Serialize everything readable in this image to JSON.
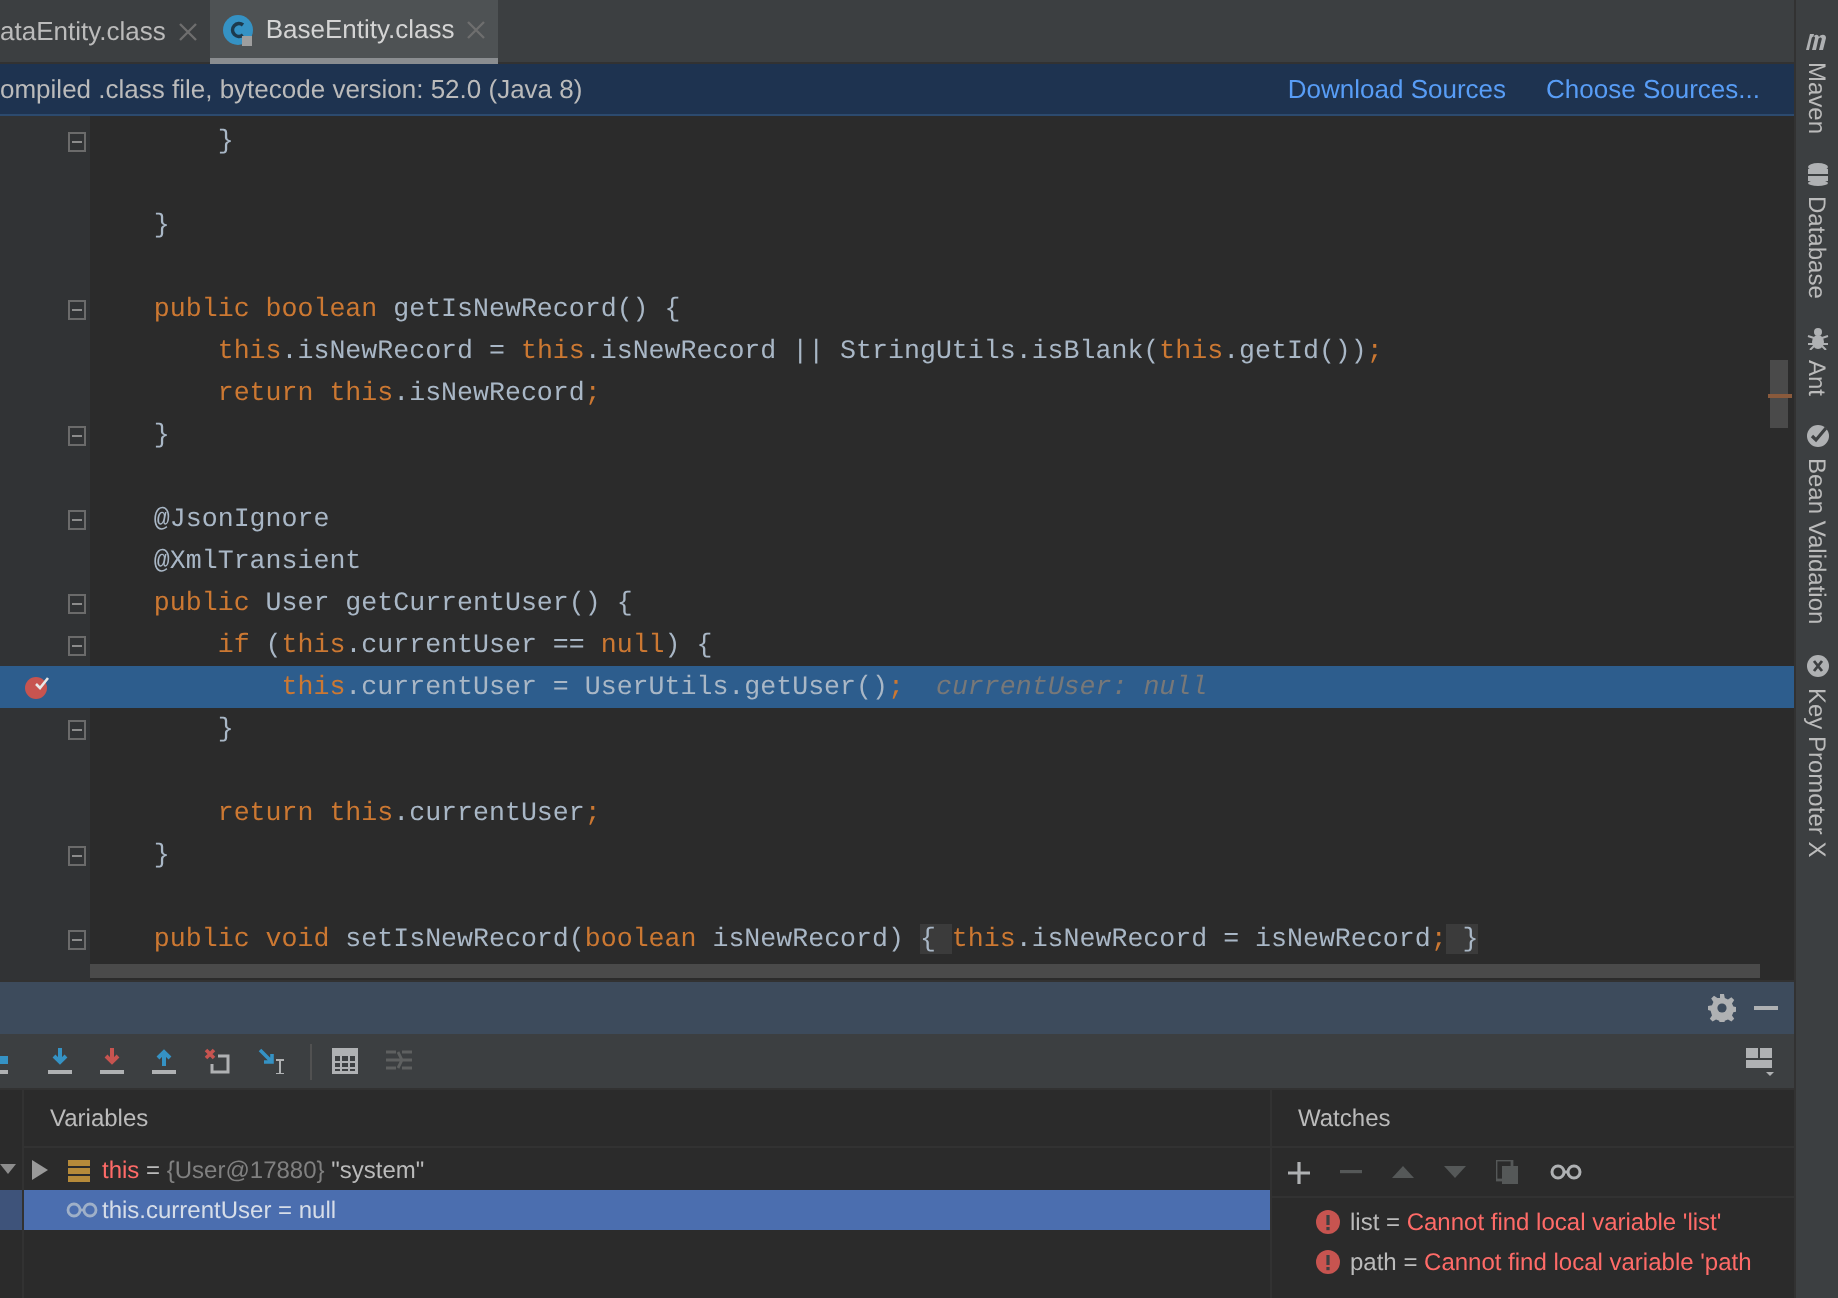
{
  "tabs": [
    {
      "label": "ataEntity.class",
      "selected": false
    },
    {
      "label": "BaseEntity.class",
      "selected": true
    }
  ],
  "banner": {
    "message": "ompiled .class file, bytecode version: 52.0 (Java 8)",
    "links": [
      "Download Sources",
      "Choose Sources..."
    ]
  },
  "code_lines": [
    {
      "fold_marker": true,
      "breakpoint": false,
      "selected": false,
      "tokens": [
        {
          "kind": "plain",
          "text": "        }"
        }
      ]
    },
    {
      "fold_marker": false,
      "breakpoint": false,
      "selected": false
    },
    {
      "fold_marker": false,
      "breakpoint": false,
      "selected": false,
      "tokens": [
        {
          "kind": "plain",
          "text": "    }"
        }
      ]
    },
    {
      "fold_marker": false,
      "breakpoint": false,
      "selected": false
    },
    {
      "fold_marker": true,
      "breakpoint": false,
      "selected": false,
      "tokens": [
        {
          "kind": "keyword",
          "text": "    public boolean "
        },
        {
          "kind": "plain",
          "text": "getIsNewRecord() {"
        }
      ]
    },
    {
      "fold_marker": false,
      "breakpoint": false,
      "selected": false,
      "tokens": [
        {
          "kind": "keyword",
          "text": "        this"
        },
        {
          "kind": "plain",
          "text": ".isNewRecord = "
        },
        {
          "kind": "keyword",
          "text": "this"
        },
        {
          "kind": "plain",
          "text": ".isNewRecord || StringUtils.isBlank("
        },
        {
          "kind": "keyword",
          "text": "this"
        },
        {
          "kind": "plain",
          "text": ".getId())"
        },
        {
          "kind": "keyword",
          "text": ";"
        }
      ]
    },
    {
      "fold_marker": false,
      "breakpoint": false,
      "selected": false,
      "tokens": [
        {
          "kind": "keyword",
          "text": "        return this"
        },
        {
          "kind": "plain",
          "text": ".isNewRecord"
        },
        {
          "kind": "keyword",
          "text": ";"
        }
      ]
    },
    {
      "fold_marker": true,
      "breakpoint": false,
      "selected": false,
      "tokens": [
        {
          "kind": "plain",
          "text": "    }"
        }
      ]
    },
    {
      "fold_marker": false,
      "breakpoint": false,
      "selected": false
    },
    {
      "fold_marker": true,
      "breakpoint": false,
      "selected": false,
      "tokens": [
        {
          "kind": "plain",
          "text": "    @JsonIgnore"
        }
      ]
    },
    {
      "fold_marker": false,
      "breakpoint": false,
      "selected": false,
      "tokens": [
        {
          "kind": "plain",
          "text": "    @XmlTransient"
        }
      ]
    },
    {
      "fold_marker": true,
      "breakpoint": false,
      "selected": false,
      "tokens": [
        {
          "kind": "keyword",
          "text": "    public "
        },
        {
          "kind": "plain",
          "text": "User getCurrentUser() {"
        }
      ]
    },
    {
      "fold_marker": true,
      "breakpoint": false,
      "selected": false,
      "tokens": [
        {
          "kind": "keyword",
          "text": "        if "
        },
        {
          "kind": "plain",
          "text": "("
        },
        {
          "kind": "keyword",
          "text": "this"
        },
        {
          "kind": "plain",
          "text": ".currentUser == "
        },
        {
          "kind": "keyword",
          "text": "null"
        },
        {
          "kind": "plain",
          "text": ") {"
        }
      ]
    },
    {
      "fold_marker": false,
      "breakpoint": true,
      "selected": true,
      "tokens": [
        {
          "kind": "keyword",
          "text": "            this"
        },
        {
          "kind": "plain",
          "text": ".currentUser = UserUtils.getUser()"
        },
        {
          "kind": "keyword",
          "text": ";"
        },
        {
          "kind": "hint",
          "text": "currentUser: null"
        }
      ]
    },
    {
      "fold_marker": true,
      "breakpoint": false,
      "selected": false,
      "tokens": [
        {
          "kind": "plain",
          "text": "        }"
        }
      ]
    },
    {
      "fold_marker": false,
      "breakpoint": false,
      "selected": false
    },
    {
      "fold_marker": false,
      "breakpoint": false,
      "selected": false,
      "tokens": [
        {
          "kind": "keyword",
          "text": "        return this"
        },
        {
          "kind": "plain",
          "text": ".currentUser"
        },
        {
          "kind": "keyword",
          "text": ";"
        }
      ]
    },
    {
      "fold_marker": true,
      "breakpoint": false,
      "selected": false,
      "tokens": [
        {
          "kind": "plain",
          "text": "    }"
        }
      ]
    },
    {
      "fold_marker": false,
      "breakpoint": false,
      "selected": false
    },
    {
      "fold_marker": true,
      "breakpoint": false,
      "selected": false,
      "tokens": [
        {
          "kind": "keyword",
          "text": "    public void "
        },
        {
          "kind": "plain",
          "text": "setIsNewRecord("
        },
        {
          "kind": "keyword",
          "text": "boolean "
        },
        {
          "kind": "plain",
          "text": "isNewRecord) "
        },
        {
          "kind": "fold",
          "text": "{ "
        },
        {
          "kind": "keyword",
          "text": "this"
        },
        {
          "kind": "plain",
          "text": ".isNewRecord = isNewRecord"
        },
        {
          "kind": "keyword",
          "text": ";"
        },
        {
          "kind": "fold",
          "text": " }"
        }
      ]
    }
  ],
  "variables": {
    "title": "Variables",
    "rows": [
      {
        "kind": "object",
        "name": "this",
        "operator": "=",
        "value_type": "{User@17880}",
        "value": "\"system\"",
        "selected": false
      },
      {
        "kind": "watch",
        "name": "this.currentUser",
        "value": "= null",
        "selected": true
      }
    ]
  },
  "watches": {
    "title": "Watches",
    "rows": [
      {
        "name": "list",
        "operator": "=",
        "error": "Cannot find local variable 'list'"
      },
      {
        "name": "path",
        "operator": "=",
        "error": "Cannot find local variable 'path"
      }
    ]
  },
  "tool_windows": [
    "Maven",
    "Database",
    "Ant",
    "Bean Validation",
    "Key Promoter X"
  ]
}
